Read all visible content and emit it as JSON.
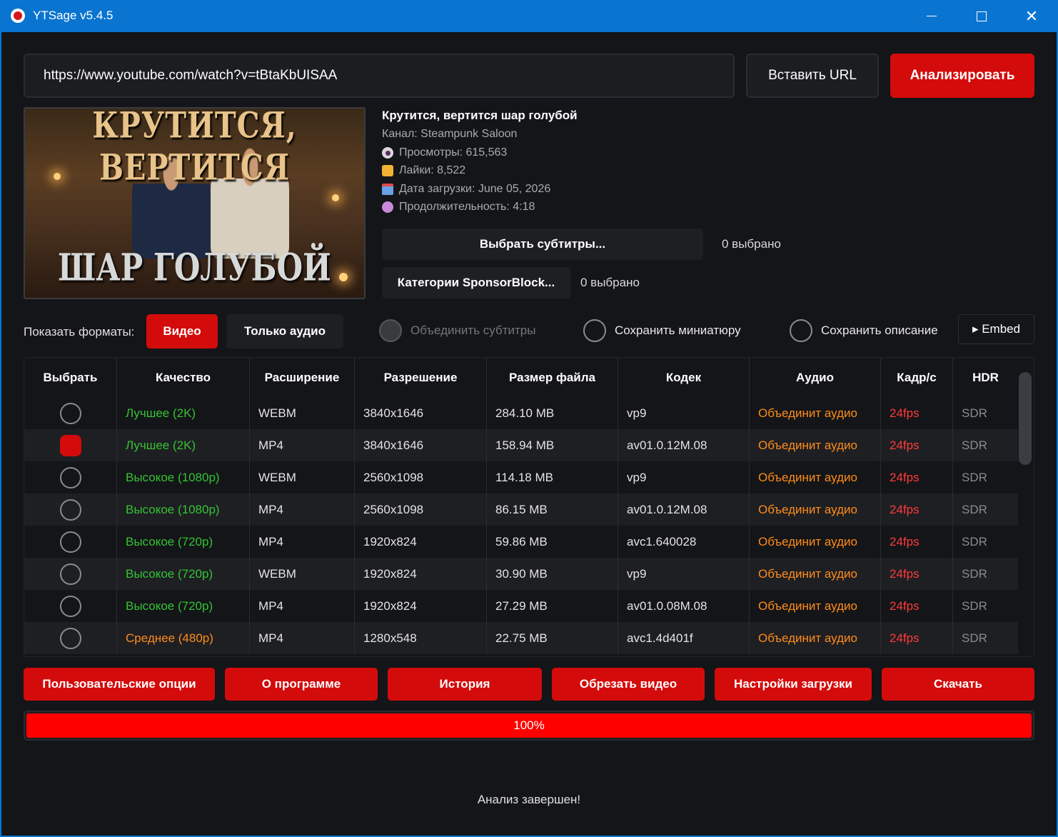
{
  "titlebar": {
    "title": "YTSage  v5.4.5"
  },
  "url_bar": {
    "value": "https://www.youtube.com/watch?v=tBtaKbUISAA",
    "paste_label": "Вставить URL",
    "analyze_label": "Анализировать"
  },
  "thumbnail": {
    "line1": "КРУТИТСЯ, ВЕРТИТСЯ",
    "line2": "ШАР ГОЛУБОЙ"
  },
  "video": {
    "title": "Крутится, вертится шар голубой",
    "channel": "Канал: Steampunk Saloon",
    "views": "Просмотры: 615,563",
    "likes": "Лайки: 8,522",
    "upload_date": "Дата загрузки: June 05, 2026",
    "duration": "Продолжительность: 4:18"
  },
  "subtitles": {
    "button_label": "Выбрать субтитры...",
    "count": "0 выбрано"
  },
  "sponsorblock": {
    "button_label": "Категории SponsorBlock...",
    "count": "0 выбрано"
  },
  "formats": {
    "label": "Показать форматы:",
    "video_label": "Видео",
    "audio_label": "Только аудио",
    "merge_subs": "Объединить субтитры",
    "save_thumb": "Сохранить миниатюру",
    "save_desc": "Сохранить описание",
    "embed_label": "▸ Embed"
  },
  "table": {
    "headers": [
      "Выбрать",
      "Качество",
      "Расширение",
      "Разрешение",
      "Размер файла",
      "Кодек",
      "Аудио",
      "Кадр/с",
      "HDR"
    ],
    "rows": [
      {
        "quality": "Лучшее (2K)",
        "ext": "WEBM",
        "res": "3840x1646",
        "size": "284.10 MB",
        "codec": "vp9",
        "audio": "Объединит аудио",
        "fps": "24fps",
        "hdr": "SDR",
        "checked": false,
        "tier": "best"
      },
      {
        "quality": "Лучшее (2K)",
        "ext": "MP4",
        "res": "3840x1646",
        "size": "158.94 MB",
        "codec": "av01.0.12M.08",
        "audio": "Объединит аудио",
        "fps": "24fps",
        "hdr": "SDR",
        "checked": true,
        "tier": "best"
      },
      {
        "quality": "Высокое (1080p)",
        "ext": "WEBM",
        "res": "2560x1098",
        "size": "114.18 MB",
        "codec": "vp9",
        "audio": "Объединит аудио",
        "fps": "24fps",
        "hdr": "SDR",
        "checked": false,
        "tier": "high"
      },
      {
        "quality": "Высокое (1080p)",
        "ext": "MP4",
        "res": "2560x1098",
        "size": "86.15 MB",
        "codec": "av01.0.12M.08",
        "audio": "Объединит аудио",
        "fps": "24fps",
        "hdr": "SDR",
        "checked": false,
        "tier": "high"
      },
      {
        "quality": "Высокое (720p)",
        "ext": "MP4",
        "res": "1920x824",
        "size": "59.86 MB",
        "codec": "avc1.640028",
        "audio": "Объединит аудио",
        "fps": "24fps",
        "hdr": "SDR",
        "checked": false,
        "tier": "high"
      },
      {
        "quality": "Высокое (720p)",
        "ext": "WEBM",
        "res": "1920x824",
        "size": "30.90 MB",
        "codec": "vp9",
        "audio": "Объединит аудио",
        "fps": "24fps",
        "hdr": "SDR",
        "checked": false,
        "tier": "high"
      },
      {
        "quality": "Высокое (720p)",
        "ext": "MP4",
        "res": "1920x824",
        "size": "27.29 MB",
        "codec": "av01.0.08M.08",
        "audio": "Объединит аудио",
        "fps": "24fps",
        "hdr": "SDR",
        "checked": false,
        "tier": "high"
      },
      {
        "quality": "Среднее (480p)",
        "ext": "MP4",
        "res": "1280x548",
        "size": "22.75 MB",
        "codec": "avc1.4d401f",
        "audio": "Объединит аудио",
        "fps": "24fps",
        "hdr": "SDR",
        "checked": false,
        "tier": "mid"
      }
    ]
  },
  "actions": {
    "custom_options": "Пользовательские опции",
    "about": "О программе",
    "history": "История",
    "trim": "Обрезать видео",
    "download_settings": "Настройки загрузки",
    "download": "Скачать"
  },
  "progress": {
    "value": 1.0,
    "label": "100%"
  },
  "status": "Анализ завершен!",
  "colors": {
    "accent": "#d40b0b",
    "titlebar": "#0a74d1",
    "background": "#141518",
    "quality_green": "#34c334",
    "quality_orange": "#ff8c1a",
    "fps_red": "#ff3b3b"
  }
}
